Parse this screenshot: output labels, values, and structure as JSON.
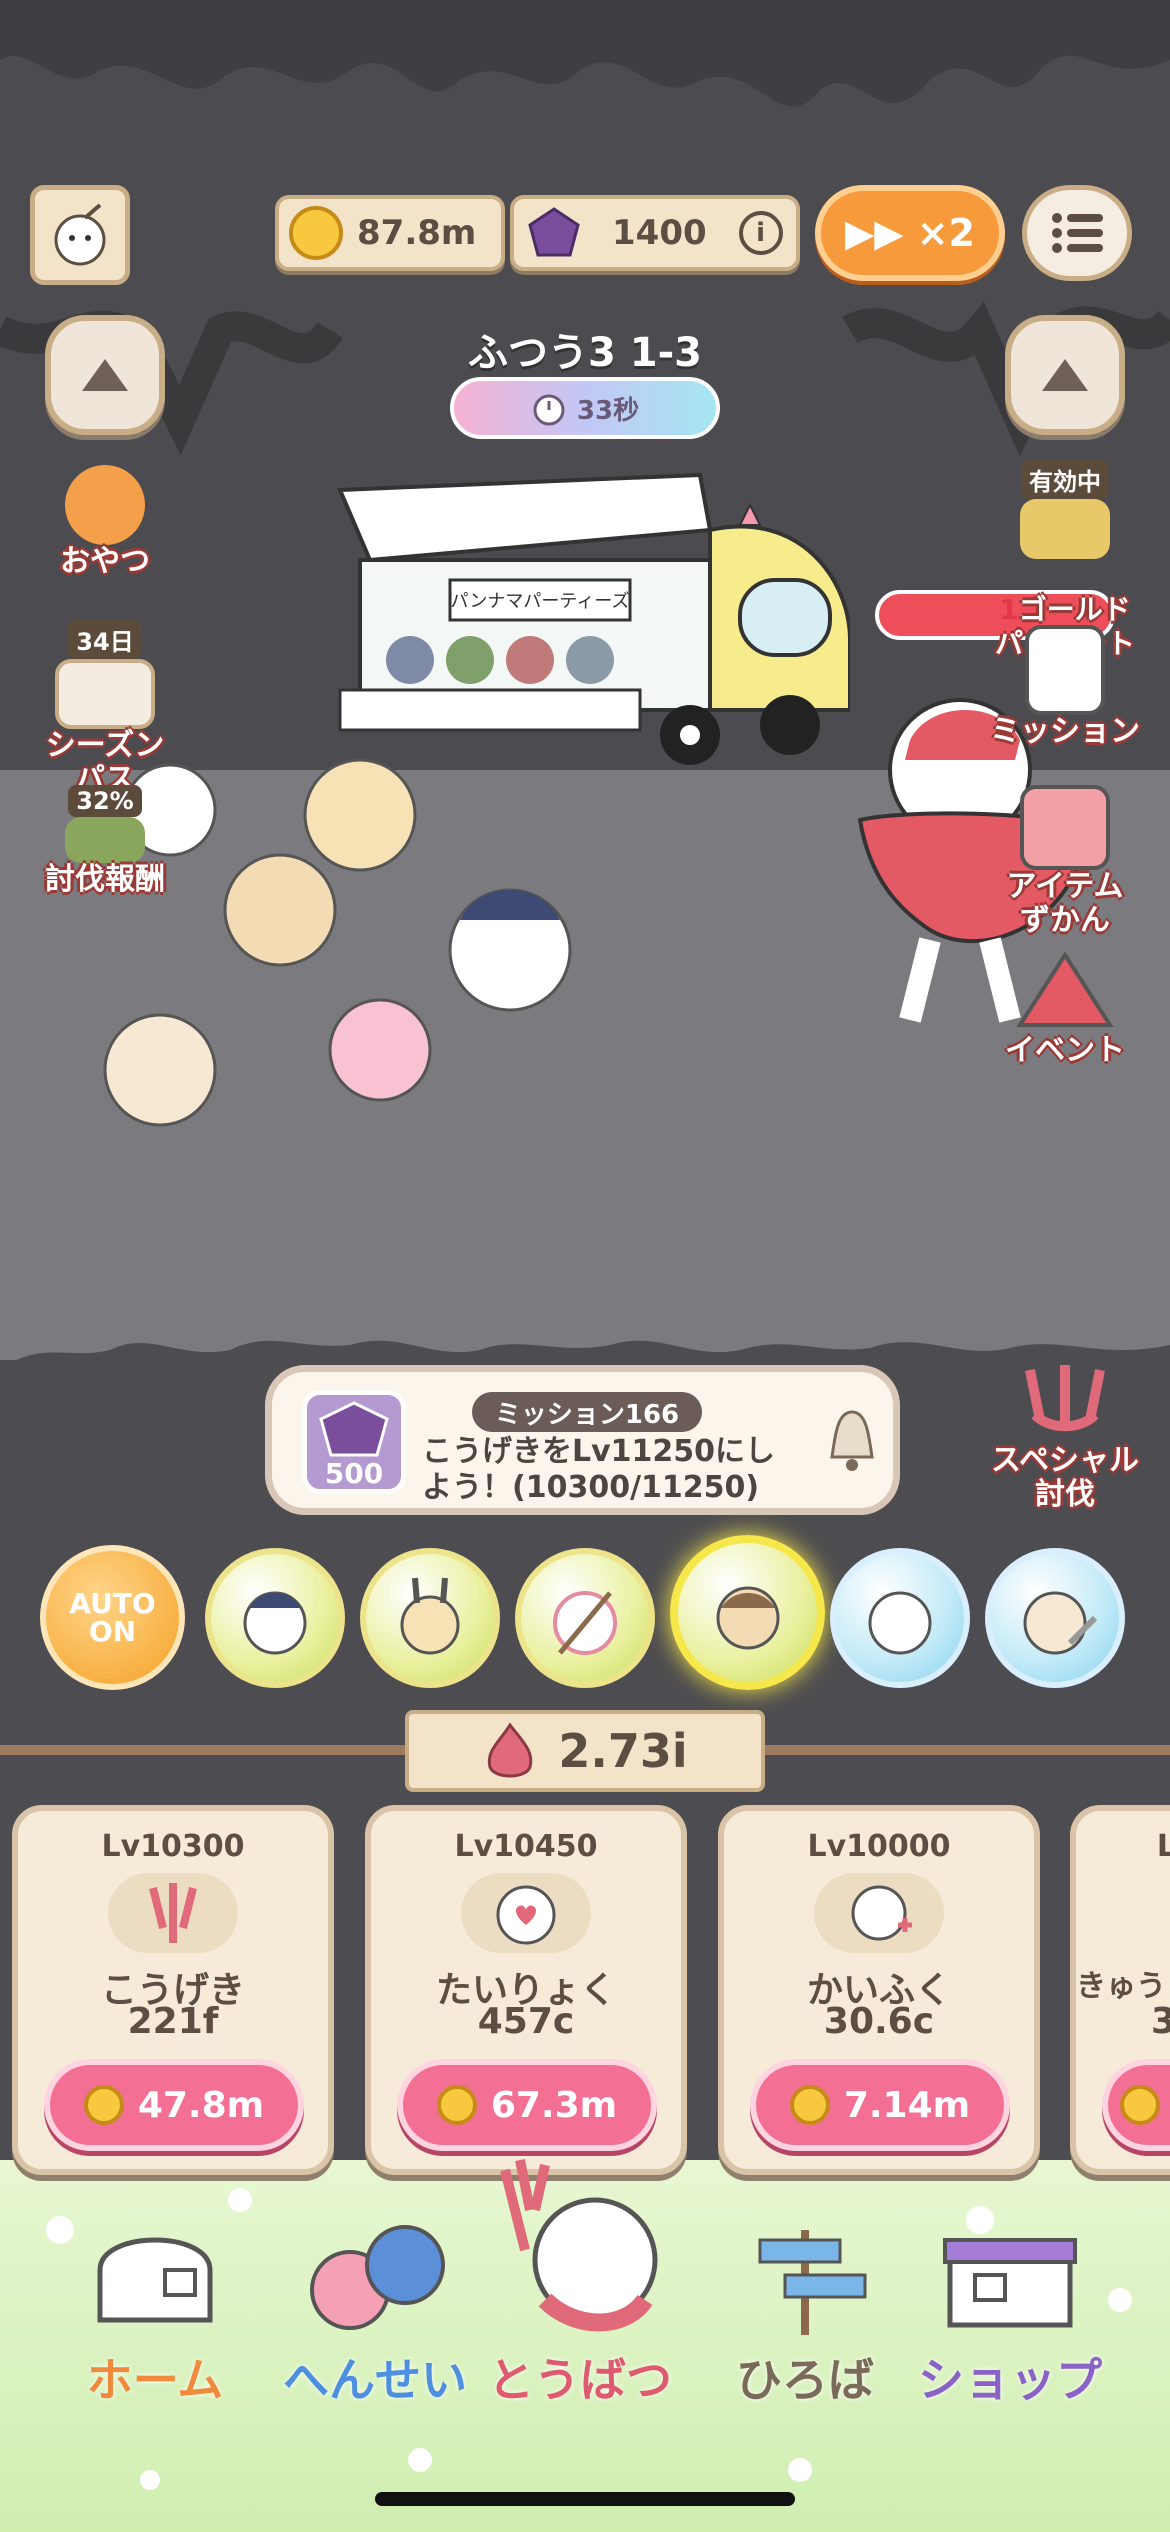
{
  "hud": {
    "gold": "87.8m",
    "gems": "1400",
    "speed": "▶▶ ×2"
  },
  "stage": {
    "name": "ふつう3 1-3",
    "timer": "33秒"
  },
  "truck_sign": "パンナマパーティーズ",
  "left_menu": [
    {
      "label": "おやつ"
    },
    {
      "label": "シーズン\nパス",
      "badge": "34日"
    },
    {
      "label": "討伐報酬",
      "badge": "32%"
    }
  ],
  "right_menu": [
    {
      "label": "ゴールド\nパスポート",
      "badge": "有効中",
      "count": "1"
    },
    {
      "label": "ミッション"
    },
    {
      "label": "アイテム\nずかん"
    },
    {
      "label": "イベント"
    },
    {
      "label": "スペシャル\n討伐"
    }
  ],
  "mission": {
    "title": "ミッション166",
    "reward": "500",
    "text_line1": "こうげきをLv11250にし",
    "text_line2": "よう！(10300/11250)"
  },
  "auto": {
    "line1": "AUTO",
    "line2": "ON"
  },
  "power": "2.73i",
  "cards": [
    {
      "level": "Lv10300",
      "name": "こうげき",
      "stat": "221f",
      "cost": "47.8m"
    },
    {
      "level": "Lv10450",
      "name": "たいりょく",
      "stat": "457c",
      "cost": "67.3m"
    },
    {
      "level": "Lv10000",
      "name": "かいふく",
      "stat": "30.6c",
      "cost": "7.14m"
    },
    {
      "level": "L",
      "name": "きゅう",
      "stat": "3",
      "cost": ""
    }
  ],
  "nav": [
    {
      "label": "ホーム",
      "color": "#f08a3c"
    },
    {
      "label": "へんせい",
      "color": "#4f8fe0"
    },
    {
      "label": "とうばつ",
      "color": "#e05a6e"
    },
    {
      "label": "ひろば",
      "color": "#7a6a5a"
    },
    {
      "label": "ショップ",
      "color": "#8a62c8"
    }
  ],
  "colors": {
    "accent": "#f79a3b",
    "cost_button": "#f36f93",
    "cave": "#4c4b4f",
    "ground": "#7b7a7e"
  }
}
